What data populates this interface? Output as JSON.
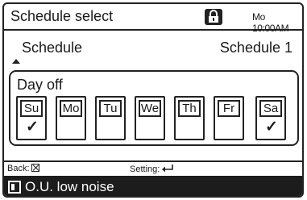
{
  "header": {
    "title": "Schedule select",
    "clock": "Mo 10:00AM"
  },
  "schedule": {
    "label": "Schedule",
    "value": "Schedule 1"
  },
  "day_off": {
    "label": "Day off",
    "days": [
      {
        "name": "Su",
        "checked": true,
        "check": "✓"
      },
      {
        "name": "Mo",
        "checked": false,
        "check": ""
      },
      {
        "name": "Tu",
        "checked": false,
        "check": ""
      },
      {
        "name": "We",
        "checked": false,
        "check": ""
      },
      {
        "name": "Th",
        "checked": false,
        "check": ""
      },
      {
        "name": "Fr",
        "checked": false,
        "check": ""
      },
      {
        "name": "Sa",
        "checked": true,
        "check": "✓"
      }
    ]
  },
  "hints": {
    "back": "Back:",
    "setting": "Setting:"
  },
  "status": {
    "text": "O.U. low noise"
  }
}
